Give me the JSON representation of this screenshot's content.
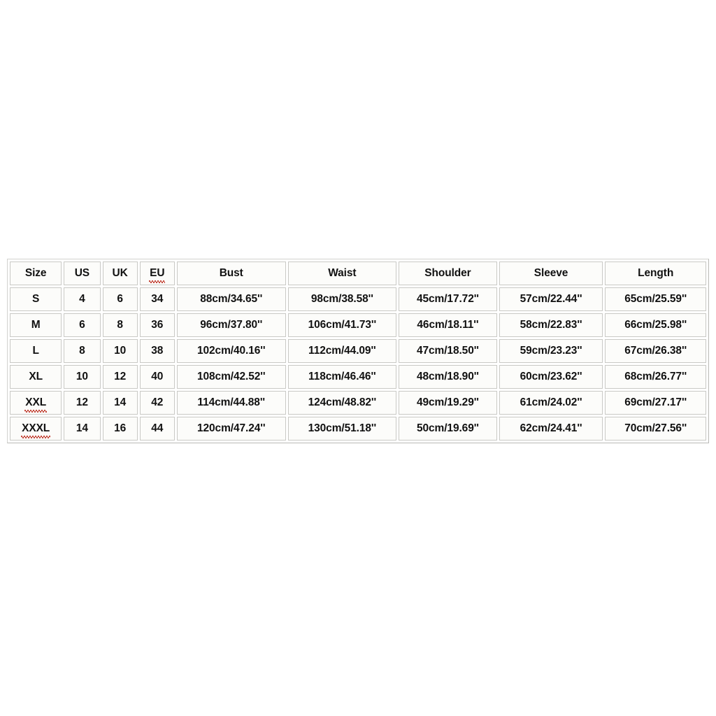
{
  "document": {
    "kind": "size-chart-table",
    "background_color": "#ffffff",
    "cell_background_color": "#fcfcfa",
    "cell_border_color": "#c9c9c5",
    "text_color": "#111111",
    "spellcheck_underline_color": "#c0392b"
  },
  "table": {
    "headers": [
      "Size",
      "US",
      "UK",
      "EU",
      "Bust",
      "Waist",
      "Shoulder",
      "Sleeve",
      "Length"
    ],
    "headers_with_spellcheck_underline": [
      "EU"
    ],
    "labels_with_spellcheck_underline": [
      "XXL",
      "XXXL"
    ],
    "rows": [
      {
        "size": "S",
        "us": "4",
        "uk": "6",
        "eu": "34",
        "bust": "88cm/34.65''",
        "waist": "98cm/38.58''",
        "shoulder": "45cm/17.72''",
        "sleeve": "57cm/22.44''",
        "length": "65cm/25.59''"
      },
      {
        "size": "M",
        "us": "6",
        "uk": "8",
        "eu": "36",
        "bust": "96cm/37.80''",
        "waist": "106cm/41.73''",
        "shoulder": "46cm/18.11''",
        "sleeve": "58cm/22.83''",
        "length": "66cm/25.98''"
      },
      {
        "size": "L",
        "us": "8",
        "uk": "10",
        "eu": "38",
        "bust": "102cm/40.16''",
        "waist": "112cm/44.09''",
        "shoulder": "47cm/18.50''",
        "sleeve": "59cm/23.23''",
        "length": "67cm/26.38''"
      },
      {
        "size": "XL",
        "us": "10",
        "uk": "12",
        "eu": "40",
        "bust": "108cm/42.52''",
        "waist": "118cm/46.46''",
        "shoulder": "48cm/18.90''",
        "sleeve": "60cm/23.62''",
        "length": "68cm/26.77''"
      },
      {
        "size": "XXL",
        "us": "12",
        "uk": "14",
        "eu": "42",
        "bust": "114cm/44.88''",
        "waist": "124cm/48.82''",
        "shoulder": "49cm/19.29''",
        "sleeve": "61cm/24.02''",
        "length": "69cm/27.17''"
      },
      {
        "size": "XXXL",
        "us": "14",
        "uk": "16",
        "eu": "44",
        "bust": "120cm/47.24''",
        "waist": "130cm/51.18''",
        "shoulder": "50cm/19.69''",
        "sleeve": "62cm/24.41''",
        "length": "70cm/27.56''"
      }
    ]
  }
}
